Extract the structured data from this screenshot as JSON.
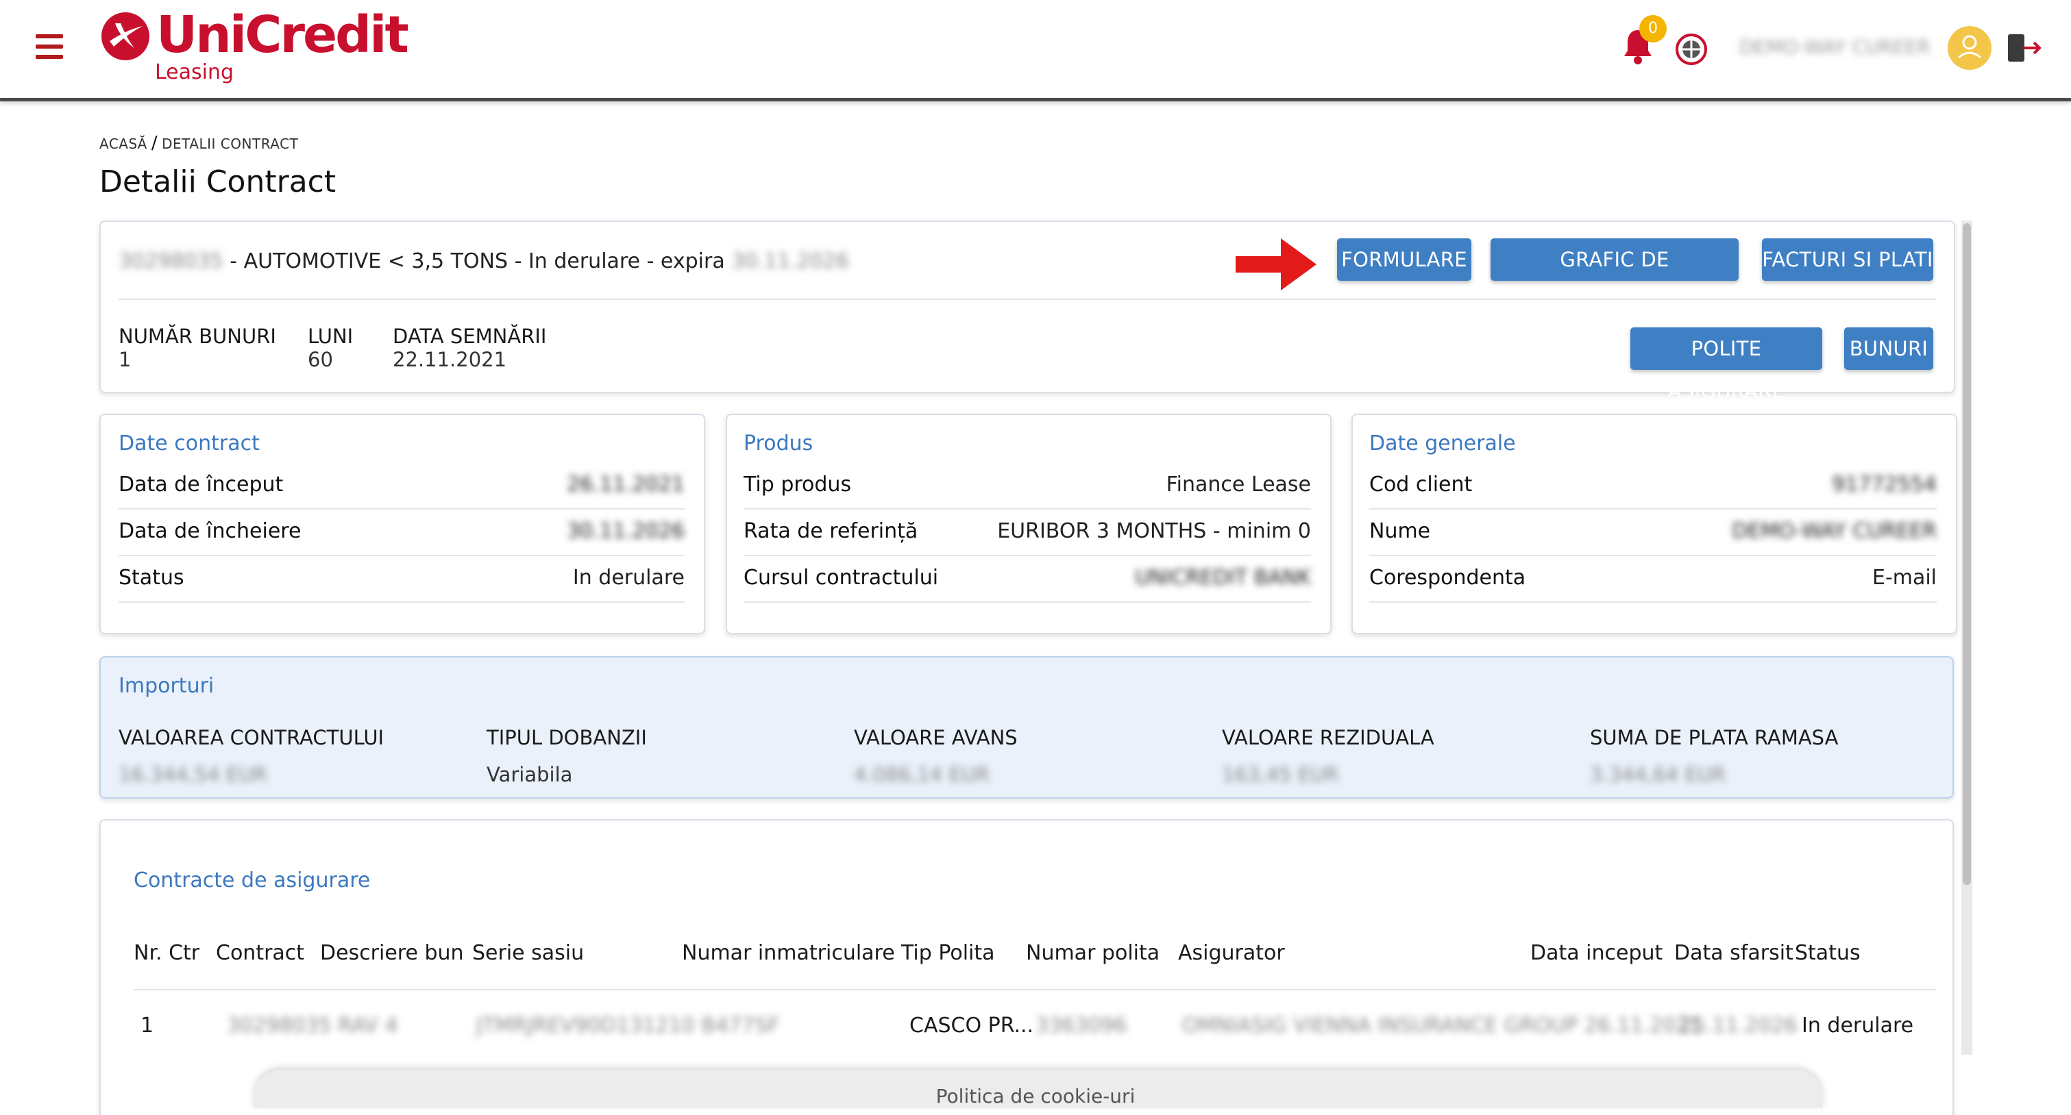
{
  "header": {
    "brand_name": "UniCredit",
    "brand_sub": "Leasing",
    "notifications_count": "0",
    "user_name": "DEMO-WAY CUREER"
  },
  "breadcrumb": {
    "home": "ACASĂ",
    "separator": "/",
    "current": "DETALII CONTRACT"
  },
  "page_title": "Detalii Contract",
  "summary": {
    "contract_number": "30298035",
    "headline": " - AUTOMOTIVE < 3,5 TONS - In derulare - expira ",
    "expiry_date": "30.11.2026",
    "buttons": {
      "formulare": "FORMULARE",
      "grafic": "GRAFIC DE RAMBURSARE",
      "facturi": "FACTURI SI PLATI",
      "polite": "POLITE ASIGURARE",
      "bunuri": "BUNURI"
    },
    "stats": [
      {
        "label": "NUMĂR BUNURI",
        "value": "1"
      },
      {
        "label": "LUNI",
        "value": "60"
      },
      {
        "label": "DATA SEMNĂRII",
        "value": "22.11.2021"
      }
    ]
  },
  "date_contract": {
    "title": "Date contract",
    "rows": [
      {
        "label": "Data de început",
        "value": "26.11.2021"
      },
      {
        "label": "Data de încheiere",
        "value": "30.11.2026"
      },
      {
        "label": "Status",
        "value": "In derulare"
      }
    ]
  },
  "produs": {
    "title": "Produs",
    "rows": [
      {
        "label": "Tip produs",
        "value": "Finance Lease"
      },
      {
        "label": "Rata de referință",
        "value": "EURIBOR 3 MONTHS - minim 0"
      },
      {
        "label": "Cursul contractului",
        "value": "UNICREDIT BANK"
      }
    ]
  },
  "date_generale": {
    "title": "Date generale",
    "rows": [
      {
        "label": "Cod client",
        "value": "91772554"
      },
      {
        "label": "Nume",
        "value": "DEMO-WAY CUREER"
      },
      {
        "label": "Corespondenta",
        "value": "E-mail"
      }
    ]
  },
  "importuri": {
    "title": "Importuri",
    "cols": [
      {
        "label": "VALOAREA CONTRACTULUI",
        "value": "16.344,54 EUR"
      },
      {
        "label": "TIPUL DOBANZII",
        "value": "Variabila"
      },
      {
        "label": "VALOARE AVANS",
        "value": "4.086,14 EUR"
      },
      {
        "label": "VALOARE REZIDUALA",
        "value": "163,45 EUR"
      },
      {
        "label": "SUMA DE PLATA RAMASA",
        "value": "3.344,64 EUR"
      }
    ]
  },
  "insurance": {
    "title": "Contracte de asigurare",
    "headers": [
      "Nr. Ctr",
      "Contract",
      "Descriere bun",
      "Serie sasiu",
      "Numar inmatriculare",
      "Tip Polita",
      "Numar polita",
      "Asigurator",
      "Data inceput",
      "Data sfarsit",
      "Status"
    ],
    "rows": [
      {
        "nr": "1",
        "contract_desc": "30298035 RAV 4",
        "serie_inmatriculare": "JTMRJREV90D131210 B477SF",
        "tip": "CASCO PR...",
        "numar": "3363096",
        "asigurator_data": "OMNIASIG VIENNA INSURANCE GROUP 26.11.2021",
        "data_sfarsit": "25.11.2026",
        "status": "In derulare"
      }
    ]
  },
  "footer": {
    "cookie_policy": "Politica de cookie-uri"
  },
  "colors": {
    "brand_red": "#c8102e",
    "accent_blue": "#3f7fc4",
    "section_title": "#3b78bf",
    "importuri_bg": "#eaf1fa",
    "badge": "#f5b400"
  }
}
